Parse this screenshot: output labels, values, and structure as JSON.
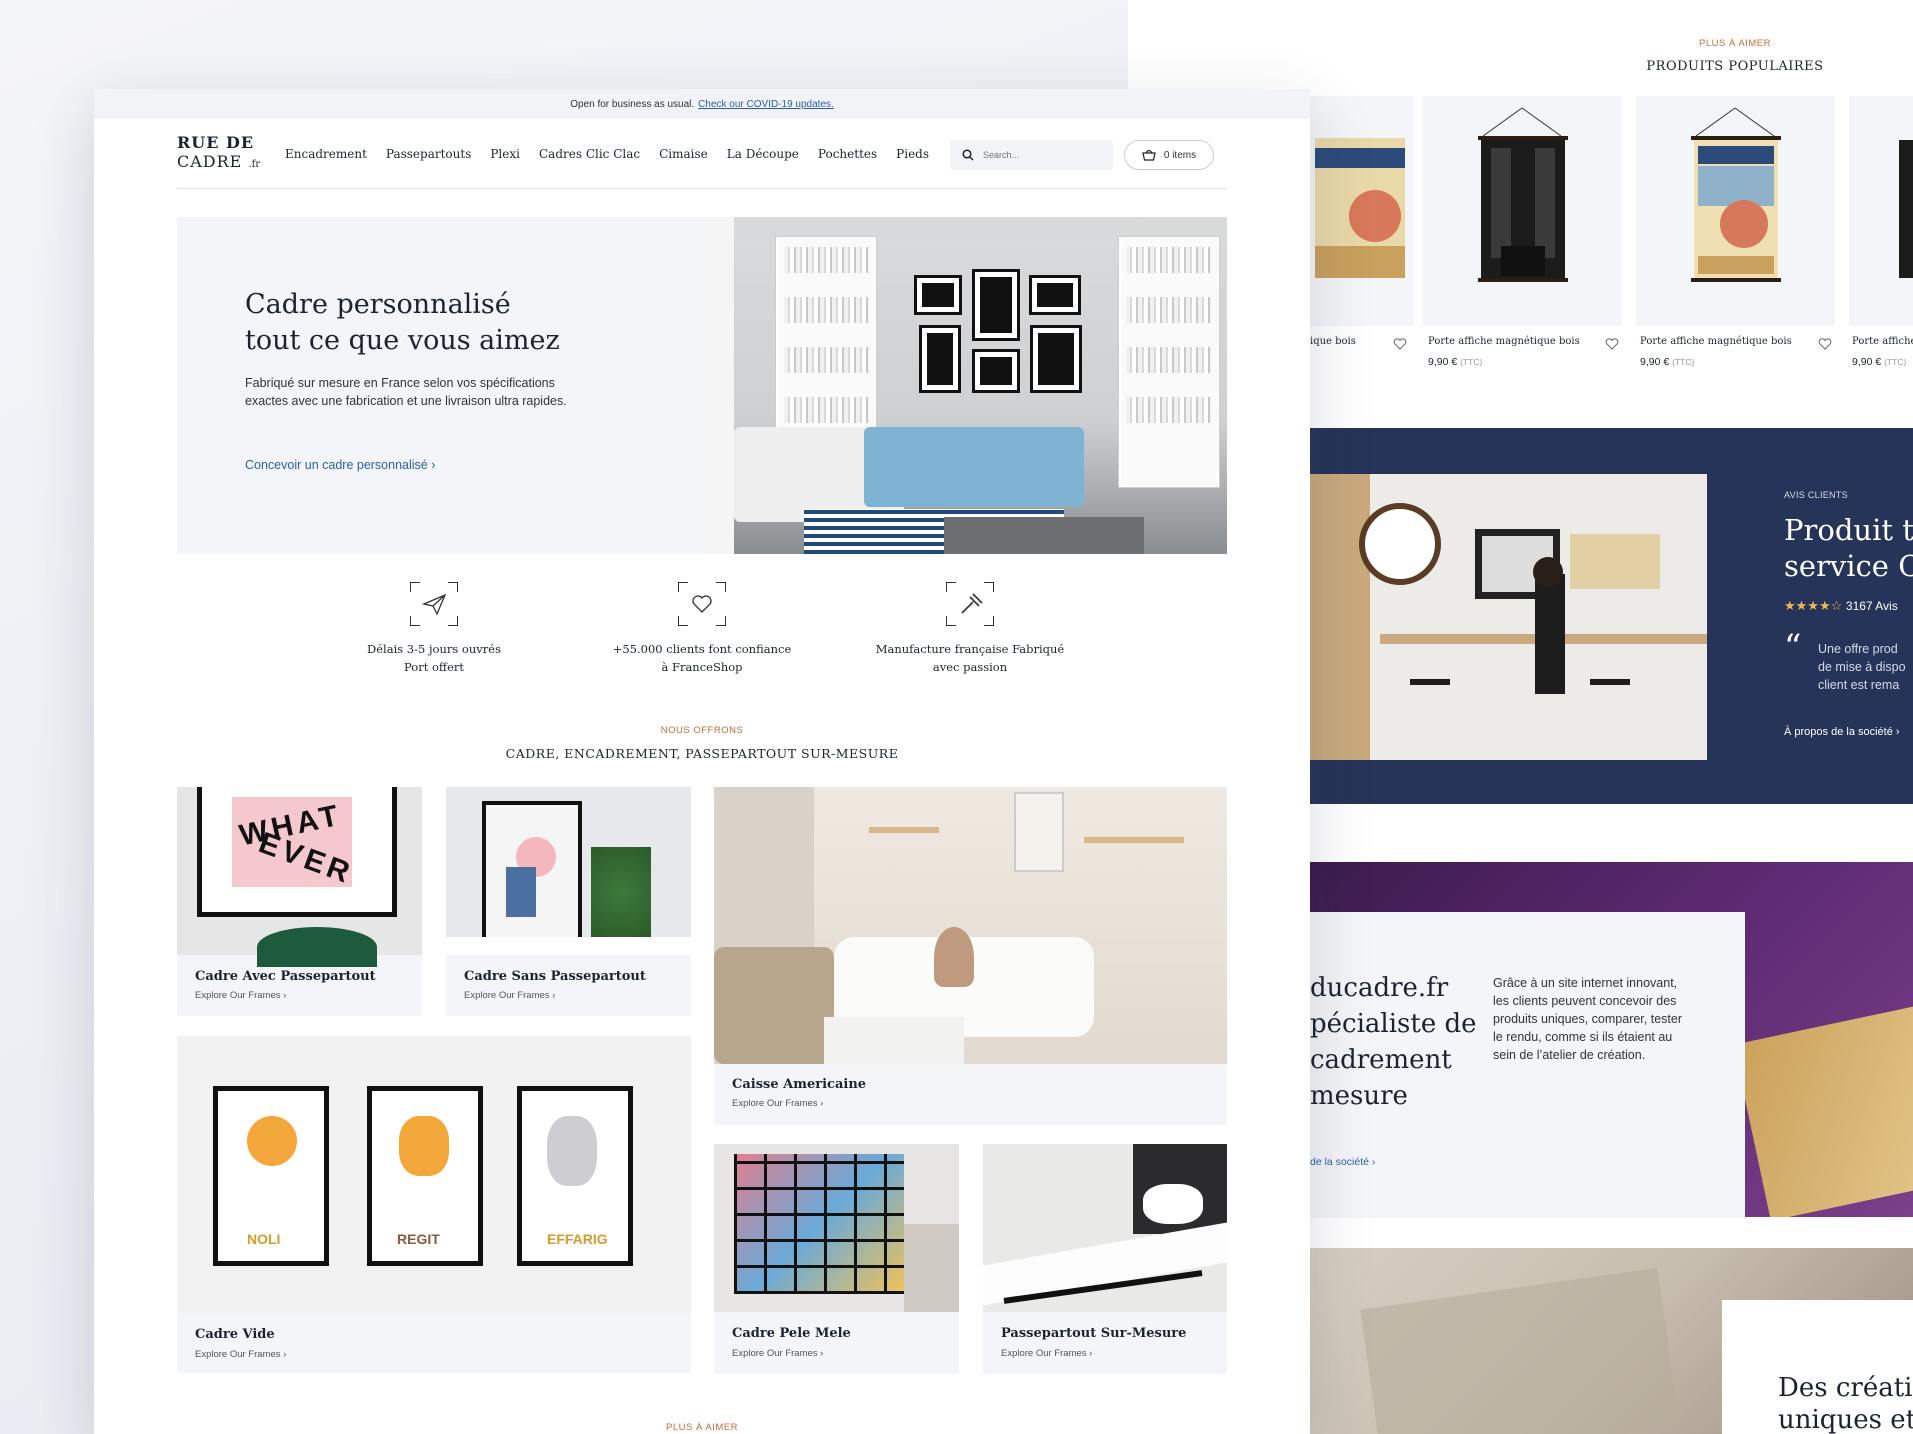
{
  "topbar": {
    "text": "Open for business as usual.",
    "link": "Check our COVID-19 updates."
  },
  "logo": {
    "line1": "RUE DE",
    "line2": "CADRE",
    "suffix": ".fr"
  },
  "nav": [
    "Encadrement",
    "Passepartouts",
    "Plexi",
    "Cadres Clic Clac",
    "Cimaise",
    "La Découpe",
    "Pochettes",
    "Pieds"
  ],
  "search": {
    "placeholder": "Search..."
  },
  "cart": {
    "label": "0 items"
  },
  "hero": {
    "title_line1": "Cadre personnalisé",
    "title_line2": "tout ce que vous aimez",
    "description": "Fabriqué sur mesure en France selon vos spécifications exactes avec une fabrication et une livraison ultra rapides.",
    "cta": "Concevoir un cadre personnalisé  ›"
  },
  "features": [
    {
      "icon": "paper-plane-icon",
      "line1": "Délais 3-5 jours ouvrés",
      "line2": "Port offert"
    },
    {
      "icon": "heart-icon",
      "line1": "+55.000 clients font confiance",
      "line2": "à FranceShop"
    },
    {
      "icon": "hammer-icon",
      "line1": "Manufacture française Fabriqué",
      "line2": "avec passion"
    }
  ],
  "offer": {
    "eyebrow": "NOUS OFFRONS",
    "title": "CADRE, ENCADREMENT, PASSEPARTOUT SUR-MESURE"
  },
  "categories": [
    {
      "title": "Cadre Avec Passepartout",
      "link": "Explore Our Frames  ›"
    },
    {
      "title": "Cadre Sans Passepartout",
      "link": "Explore Our Frames  ›"
    },
    {
      "title": "Caisse Americaine",
      "link": "Explore Our Frames  ›"
    },
    {
      "title": "Cadre Vide",
      "link": "Explore Our Frames  ›"
    },
    {
      "title": "Cadre Pele Mele",
      "link": "Explore Our Frames  ›"
    },
    {
      "title": "Passepartout Sur-Mesure",
      "link": "Explore Our Frames  ›"
    }
  ],
  "bottom_eyebrow": "PLUS À AIMER",
  "popular": {
    "eyebrow": "PLUS À AIMER",
    "title": "PRODUITS POPULAIRES",
    "products": [
      {
        "name": "Porte affiche magnétique bois",
        "visible_name": "ique bois",
        "price": "",
        "tax": ""
      },
      {
        "name": "Porte affiche magnétique bois",
        "price": "9,90 €",
        "tax": "(TTC)"
      },
      {
        "name": "Porte affiche magnétique bois",
        "price": "9,90 €",
        "tax": "(TTC)"
      },
      {
        "name": "Porte affiche m",
        "price": "9,90 €",
        "tax": "(TTC)"
      }
    ]
  },
  "reviews": {
    "eyebrow": "AVIS CLIENTS",
    "title_line1": "Produit tr",
    "title_line2": "service Cl",
    "rating_count": "3167 Avis",
    "quote_line1": "Une offre prod",
    "quote_line2": "de mise à dispo",
    "quote_line3": "client est rema",
    "link": "À propos de la société  ›"
  },
  "about": {
    "title_line1": "ducadre.fr",
    "title_line2": "pécialiste de",
    "title_line3": "cadrement",
    "title_line4": "mesure",
    "text": "Grâce à un site internet innovant, les clients  peuvent concevoir des produits uniques, comparer, tester le rendu, comme si ils étaient au sein de l’atelier de création.",
    "link": "de la société  ›"
  },
  "bottom_card": {
    "title_line1": "Des créatio",
    "title_line2": "uniques et"
  },
  "colors": {
    "accent": "#2b5db8",
    "eyebrow": "#c56d3a",
    "navy": "#263459",
    "panel": "#f4f5f8"
  }
}
